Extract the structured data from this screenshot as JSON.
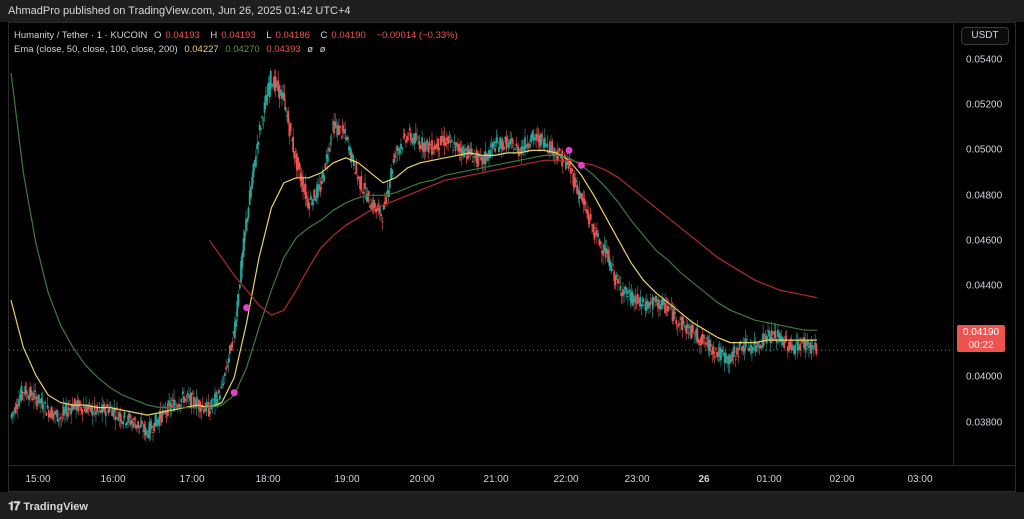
{
  "header": {
    "publish_text": "AhmadPro published on TradingView.com, Jun 26, 2025 01:42 UTC+4"
  },
  "legend": {
    "symbol": "Humanity / Tether · 1 · KUCOIN",
    "o_label": "O",
    "o_value": "0.04193",
    "h_label": "H",
    "h_value": "0.04193",
    "l_label": "L",
    "l_value": "0.04186",
    "c_label": "C",
    "c_value": "0.04190",
    "change": "−0.00014 (−0.33%)",
    "indicator": "Ema (close, 50, close, 100, close, 200)",
    "ema50": "0.04227",
    "ema100": "0.04270",
    "ema200": "0.04393",
    "extra1": "ø",
    "extra2": "ø"
  },
  "currency_button": "USDT",
  "price_axis": [
    "0.05400",
    "0.05200",
    "0.05000",
    "0.04800",
    "0.04600",
    "0.04400",
    "0.04000",
    "0.03800"
  ],
  "time_axis": [
    "15:00",
    "16:00",
    "17:00",
    "18:00",
    "19:00",
    "20:00",
    "21:00",
    "22:00",
    "23:00",
    "26",
    "01:00",
    "02:00",
    "03:00"
  ],
  "last_price": {
    "value": "0.04190",
    "countdown": "00:22"
  },
  "footer": {
    "brand": "TradingView"
  },
  "colors": {
    "up": "#26a69a",
    "down": "#ef5350",
    "ema50": "#e6d36a",
    "ema100": "#3f7a3a",
    "ema200": "#b22b2b",
    "cross_marker": "#e040c8",
    "price_line": "#ef5350"
  },
  "chart_data": {
    "type": "line",
    "title": "Humanity / Tether · 1 · KUCOIN",
    "xlabel": "",
    "ylabel": "",
    "ylim": [
      0.0373,
      0.055
    ],
    "x": [
      "14:50",
      "15:00",
      "15:10",
      "15:20",
      "15:30",
      "15:40",
      "15:50",
      "16:00",
      "16:10",
      "16:20",
      "16:30",
      "16:40",
      "16:50",
      "17:00",
      "17:10",
      "17:20",
      "17:30",
      "17:40",
      "17:50",
      "18:00",
      "18:10",
      "18:20",
      "18:30",
      "18:40",
      "18:50",
      "19:00",
      "19:10",
      "19:20",
      "19:30",
      "19:40",
      "19:50",
      "20:00",
      "20:10",
      "20:20",
      "20:30",
      "20:40",
      "20:50",
      "21:00",
      "21:10",
      "21:20",
      "21:30",
      "21:40",
      "21:50",
      "22:00",
      "22:10",
      "22:20",
      "22:30",
      "22:40",
      "22:50",
      "23:00",
      "23:10",
      "23:20",
      "23:30",
      "23:40",
      "23:50",
      "00:00",
      "00:10",
      "00:20",
      "00:30",
      "00:40",
      "00:50",
      "01:00",
      "01:10",
      "01:20",
      "01:30",
      "01:40"
    ],
    "series": [
      {
        "name": "",
        "values": [
          0.0392,
          0.0403,
          0.04,
          0.0395,
          0.0392,
          0.0397,
          0.0396,
          0.0394,
          0.0396,
          0.0392,
          0.039,
          0.0386,
          0.0392,
          0.0397,
          0.04,
          0.0398,
          0.0395,
          0.0403,
          0.0425,
          0.047,
          0.0505,
          0.0528,
          0.052,
          0.0495,
          0.0478,
          0.0484,
          0.0509,
          0.0505,
          0.0488,
          0.0478,
          0.0473,
          0.0498,
          0.0505,
          0.0502,
          0.05,
          0.0503,
          0.05,
          0.0498,
          0.0494,
          0.0501,
          0.0502,
          0.0499,
          0.0504,
          0.0503,
          0.0498,
          0.0493,
          0.048,
          0.0467,
          0.0458,
          0.0445,
          0.044,
          0.0437,
          0.0438,
          0.0436,
          0.043,
          0.0426,
          0.0422,
          0.0418,
          0.0415,
          0.0421,
          0.042,
          0.0425,
          0.0424,
          0.042,
          0.0422,
          0.0419
        ]
      },
      {
        "name": "",
        "values": [
          0.0439,
          0.042,
          0.0409,
          0.0401,
          0.0398,
          0.0397,
          0.0397,
          0.0396,
          0.0396,
          0.0395,
          0.0394,
          0.0393,
          0.0394,
          0.0395,
          0.0396,
          0.0397,
          0.0396,
          0.0398,
          0.0408,
          0.043,
          0.0456,
          0.0476,
          0.0486,
          0.0488,
          0.0488,
          0.049,
          0.0494,
          0.0496,
          0.0494,
          0.049,
          0.0486,
          0.0488,
          0.0492,
          0.0494,
          0.0495,
          0.0496,
          0.0497,
          0.0498,
          0.0497,
          0.0497,
          0.0498,
          0.0498,
          0.0499,
          0.0499,
          0.0498,
          0.0495,
          0.0489,
          0.0481,
          0.0472,
          0.0463,
          0.0454,
          0.0447,
          0.0442,
          0.0438,
          0.0434,
          0.043,
          0.0427,
          0.0424,
          0.0422,
          0.0422,
          0.0422,
          0.0423,
          0.0423,
          0.0423,
          0.0423,
          0.0423
        ]
      },
      {
        "name": "",
        "values": [
          0.053,
          0.049,
          0.0462,
          0.0442,
          0.0429,
          0.042,
          0.0413,
          0.0408,
          0.0404,
          0.0401,
          0.0399,
          0.0397,
          0.0396,
          0.0396,
          0.0396,
          0.0396,
          0.0396,
          0.0397,
          0.0401,
          0.0412,
          0.0428,
          0.0443,
          0.0456,
          0.0464,
          0.0468,
          0.0471,
          0.0475,
          0.0478,
          0.048,
          0.0481,
          0.0481,
          0.0482,
          0.0484,
          0.0486,
          0.0487,
          0.0489,
          0.049,
          0.0491,
          0.0492,
          0.0493,
          0.0494,
          0.0495,
          0.0496,
          0.0497,
          0.0497,
          0.0496,
          0.0493,
          0.0489,
          0.0484,
          0.0478,
          0.0471,
          0.0465,
          0.0459,
          0.0455,
          0.045,
          0.0446,
          0.0442,
          0.0438,
          0.0435,
          0.0433,
          0.0431,
          0.043,
          0.0429,
          0.0428,
          0.0427,
          0.0427
        ]
      },
      {
        "name": "",
        "values": [
          null,
          null,
          null,
          null,
          null,
          null,
          null,
          null,
          null,
          null,
          null,
          null,
          null,
          null,
          null,
          null,
          0.0463,
          0.0456,
          0.0449,
          0.0443,
          0.0437,
          0.0433,
          0.0435,
          0.0443,
          0.0452,
          0.046,
          0.0465,
          0.0469,
          0.0472,
          0.0475,
          0.0477,
          0.0479,
          0.0481,
          0.0483,
          0.0485,
          0.0487,
          0.0488,
          0.0489,
          0.049,
          0.0491,
          0.0492,
          0.0493,
          0.0494,
          0.0495,
          0.0495,
          0.0495,
          0.0494,
          0.0493,
          0.0491,
          0.0488,
          0.0484,
          0.048,
          0.0476,
          0.0472,
          0.0468,
          0.0464,
          0.046,
          0.0456,
          0.0453,
          0.045,
          0.0447,
          0.0445,
          0.0443,
          0.0442,
          0.0441,
          0.044
        ]
      }
    ],
    "cross_markers": [
      {
        "x": "17:50",
        "y": 0.0402
      },
      {
        "x": "18:00",
        "y": 0.0436
      },
      {
        "x": "22:20",
        "y": 0.0499
      },
      {
        "x": "22:30",
        "y": 0.0493
      }
    ],
    "last_price": 0.0419
  }
}
